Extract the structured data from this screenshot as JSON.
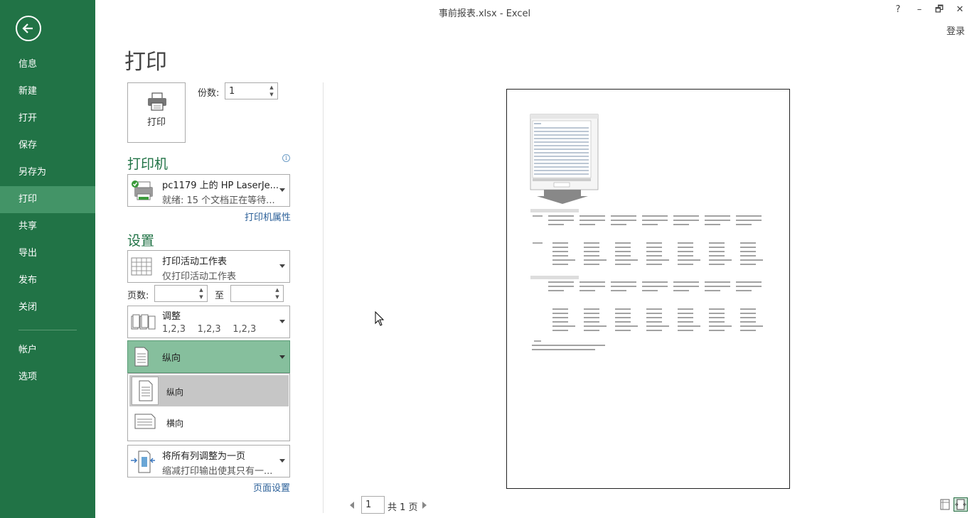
{
  "window": {
    "title": "事前报表.xlsx - Excel",
    "help": "?",
    "minimize": "–",
    "restore": "🗗",
    "close": "✕",
    "login": "登录"
  },
  "nav": {
    "items": [
      {
        "label": "信息"
      },
      {
        "label": "新建"
      },
      {
        "label": "打开"
      },
      {
        "label": "保存"
      },
      {
        "label": "另存为"
      },
      {
        "label": "打印"
      },
      {
        "label": "共享"
      },
      {
        "label": "导出"
      },
      {
        "label": "发布"
      },
      {
        "label": "关闭"
      },
      {
        "label": "帐户"
      },
      {
        "label": "选项"
      }
    ],
    "active": "打印"
  },
  "print": {
    "title": "打印",
    "button_label": "打印",
    "copies_label": "份数:",
    "copies_value": "1"
  },
  "printer": {
    "heading": "打印机",
    "name": "pc1179 上的 HP LaserJe...",
    "status": "就绪: 15 个文档正在等待...",
    "properties_link": "打印机属性"
  },
  "settings": {
    "heading": "设置",
    "scope_main": "打印活动工作表",
    "scope_sub": "仅打印活动工作表",
    "pages_label": "页数:",
    "to_label": "至",
    "pages_from": "",
    "pages_to": "",
    "collate_main": "调整",
    "collate_sub": "1,2,3    1,2,3    1,2,3",
    "orientation_selected": "纵向",
    "orientation_options": [
      {
        "label": "纵向"
      },
      {
        "label": "横向"
      }
    ],
    "scaling_main": "将所有列调整为一页",
    "scaling_sub": "缩减打印输出使其只有一...",
    "page_setup_link": "页面设置"
  },
  "pager": {
    "current": "1",
    "total_text": "共 1 页"
  },
  "colors": {
    "accent": "#217346",
    "nav_active": "#439467",
    "orient_sel": "#86bf9d",
    "link": "#2a5f98"
  },
  "icons": [
    "back-arrow-icon",
    "printer-icon",
    "printer-device-icon",
    "sheet-icon",
    "collate-icon",
    "portrait-icon",
    "landscape-icon",
    "scale-icon",
    "info-icon",
    "show-margins-icon",
    "zoom-page-icon"
  ]
}
